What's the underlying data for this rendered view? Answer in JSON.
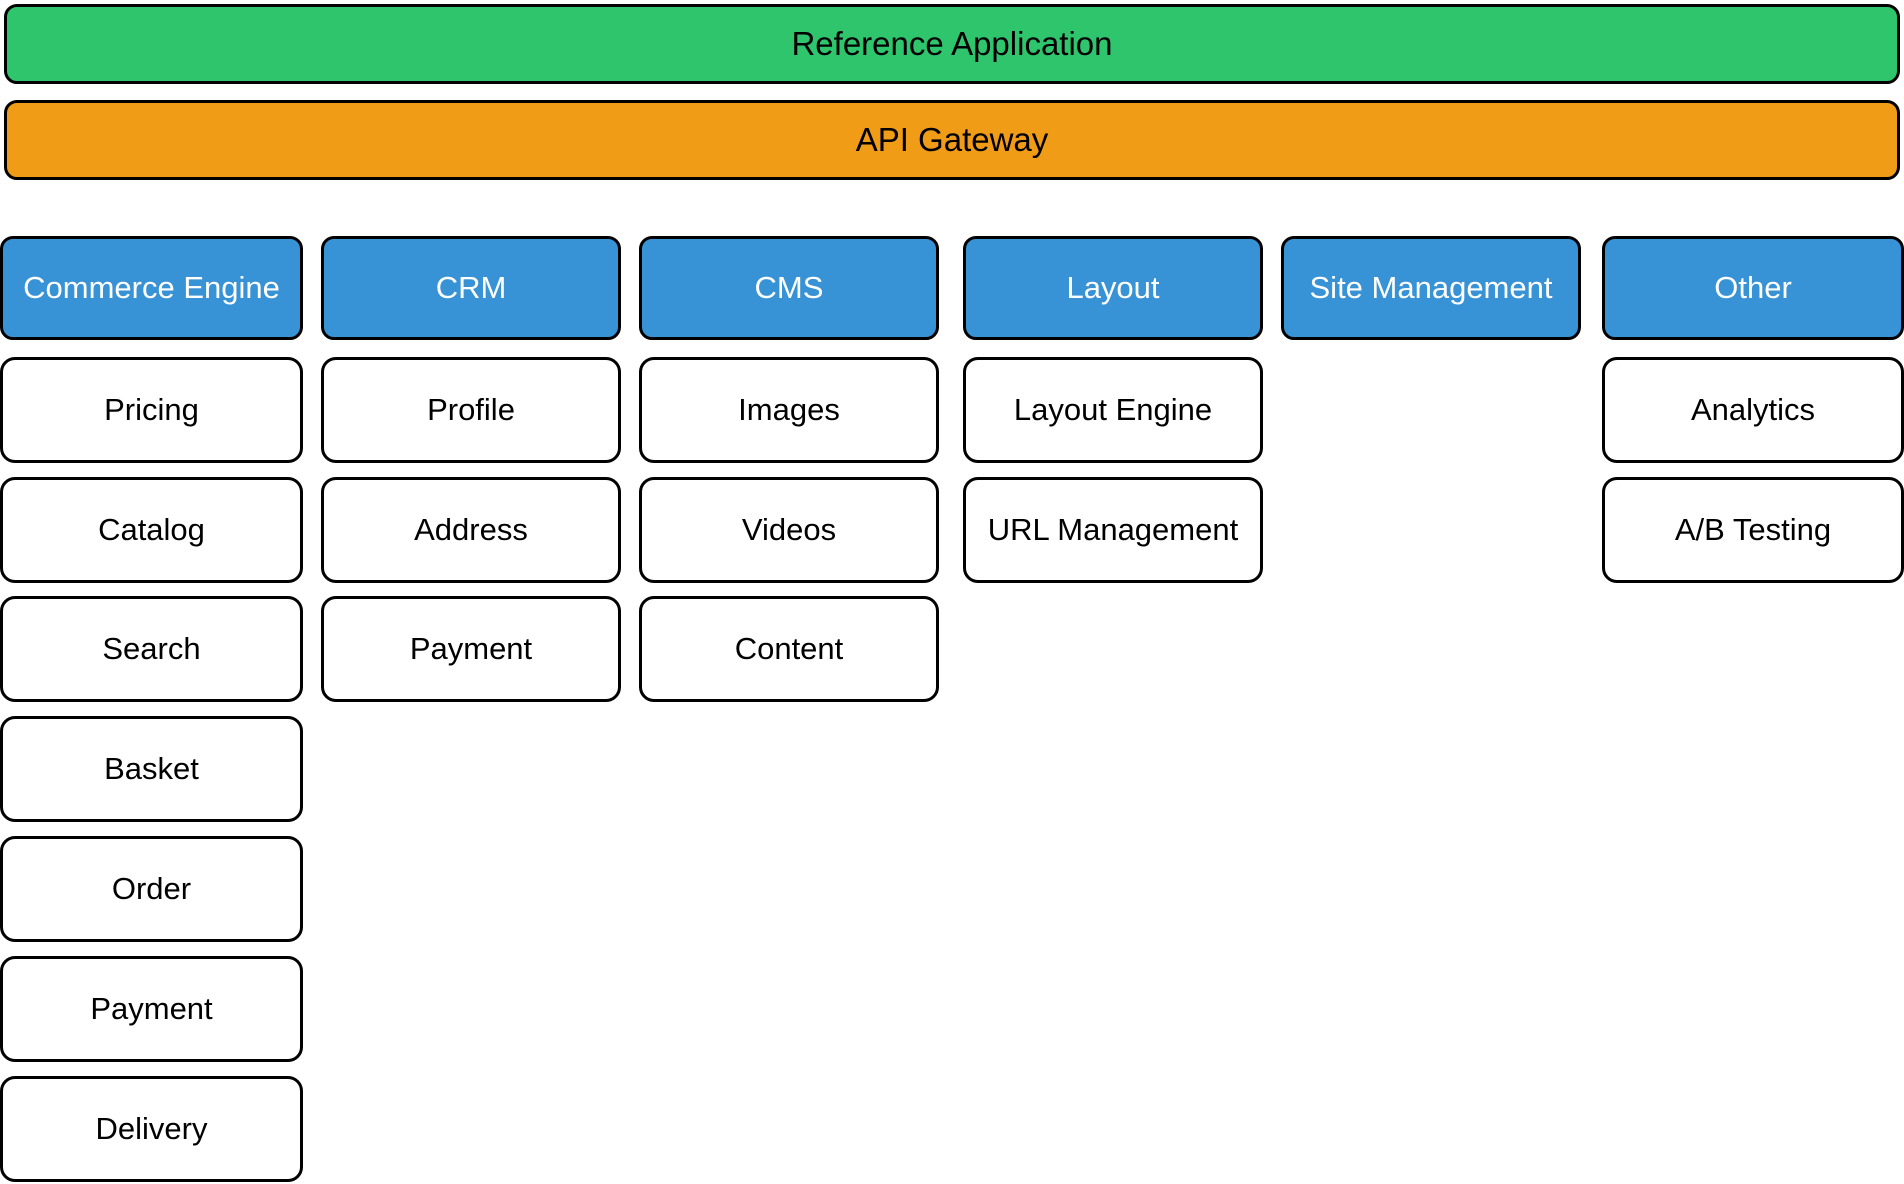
{
  "diagram": {
    "title_banner": "Reference Application",
    "gateway_banner": "API Gateway",
    "colors": {
      "application": "#2ec56d",
      "gateway": "#f09c16",
      "domain_header": "#3892d6",
      "service": "#ffffff",
      "border": "#000000"
    },
    "columns": [
      {
        "header": "Commerce Engine",
        "services": [
          "Pricing",
          "Catalog",
          "Search",
          "Basket",
          "Order",
          "Payment",
          "Delivery"
        ]
      },
      {
        "header": "CRM",
        "services": [
          "Profile",
          "Address",
          "Payment"
        ]
      },
      {
        "header": "CMS",
        "services": [
          "Images",
          "Videos",
          "Content"
        ]
      },
      {
        "header": "Layout",
        "services": [
          "Layout Engine",
          "URL Management"
        ]
      },
      {
        "header": "Site Management",
        "services": []
      },
      {
        "header": "Other",
        "services": [
          "Analytics",
          "A/B Testing"
        ]
      }
    ]
  }
}
